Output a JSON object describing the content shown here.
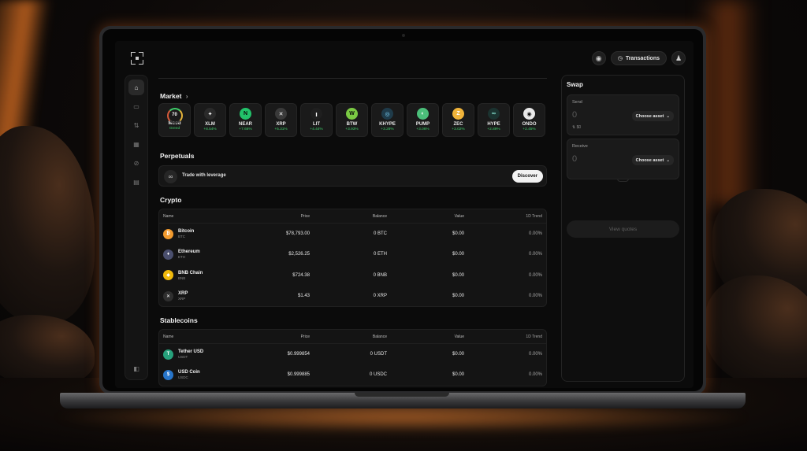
{
  "topbar": {
    "transactions_label": "Transactions"
  },
  "market": {
    "title": "Market",
    "title_arrow": "›",
    "mood": {
      "value": "70",
      "label": "Mood",
      "status": "Greed"
    },
    "coins": [
      {
        "sym": "XLM",
        "chg": "+8.54%",
        "color": "#2a2a2a",
        "glyph": "✦"
      },
      {
        "sym": "NEAR",
        "chg": "+7.66%",
        "color": "#22c26a",
        "glyph": "N"
      },
      {
        "sym": "XRP",
        "chg": "+5.31%",
        "color": "#3a3a3a",
        "glyph": "✕"
      },
      {
        "sym": "LIT",
        "chg": "+4.44%",
        "color": "#1f1f1f",
        "glyph": "ı"
      },
      {
        "sym": "BTW",
        "chg": "+3.93%",
        "color": "#7ac943",
        "glyph": "W"
      },
      {
        "sym": "KHYPE",
        "chg": "+3.28%",
        "color": "#1f3b4a",
        "glyph": "◎"
      },
      {
        "sym": "PUMP",
        "chg": "+3.06%",
        "color": "#4bbf7a",
        "glyph": "◐"
      },
      {
        "sym": "ZEC",
        "chg": "+3.02%",
        "color": "#f0b43a",
        "glyph": "Z"
      },
      {
        "sym": "HYPE",
        "chg": "+2.89%",
        "color": "#1b3330",
        "glyph": "∞"
      },
      {
        "sym": "ONDO",
        "chg": "+2.45%",
        "color": "#e8e8e8",
        "glyph": "◉"
      }
    ]
  },
  "perpetuals": {
    "title": "Perpetuals",
    "text": "Trade with leverage",
    "button": "Discover"
  },
  "table_headers": {
    "name": "Name",
    "price": "Price",
    "balance": "Balance",
    "value": "Value",
    "trend": "1D Trend"
  },
  "crypto": {
    "title": "Crypto",
    "rows": [
      {
        "name": "Bitcoin",
        "sym": "BTC",
        "price": "$78,793.00",
        "balance": "0 BTC",
        "value": "$0.00",
        "trend": "0.00%",
        "color": "#f29a2e",
        "glyph": "₿"
      },
      {
        "name": "Ethereum",
        "sym": "ETH",
        "price": "$2,526.25",
        "balance": "0 ETH",
        "value": "$0.00",
        "trend": "0.00%",
        "color": "#4a4f6e",
        "glyph": "♦"
      },
      {
        "name": "BNB Chain",
        "sym": "BNB",
        "price": "$724.38",
        "balance": "0 BNB",
        "value": "$0.00",
        "trend": "0.00%",
        "color": "#f0b90b",
        "glyph": "◆"
      },
      {
        "name": "XRP",
        "sym": "XRP",
        "price": "$1.43",
        "balance": "0 XRP",
        "value": "$0.00",
        "trend": "0.00%",
        "color": "#2f2f2f",
        "glyph": "✕"
      }
    ]
  },
  "stablecoins": {
    "title": "Stablecoins",
    "rows": [
      {
        "name": "Tether USD",
        "sym": "USDT",
        "price": "$0.999854",
        "balance": "0 USDT",
        "value": "$0.00",
        "trend": "0.00%",
        "color": "#26a17b",
        "glyph": "T"
      },
      {
        "name": "USD Coin",
        "sym": "USDC",
        "price": "$0.999885",
        "balance": "0 USDC",
        "value": "$0.00",
        "trend": "0.00%",
        "color": "#2775ca",
        "glyph": "$"
      }
    ]
  },
  "swap": {
    "title": "Swap",
    "send_label": "Send",
    "send_amount": "0",
    "send_usd": "$0",
    "receive_label": "Receive",
    "receive_amount": "0",
    "choose_asset": "Choose asset",
    "view_quotes": "View quotes"
  }
}
